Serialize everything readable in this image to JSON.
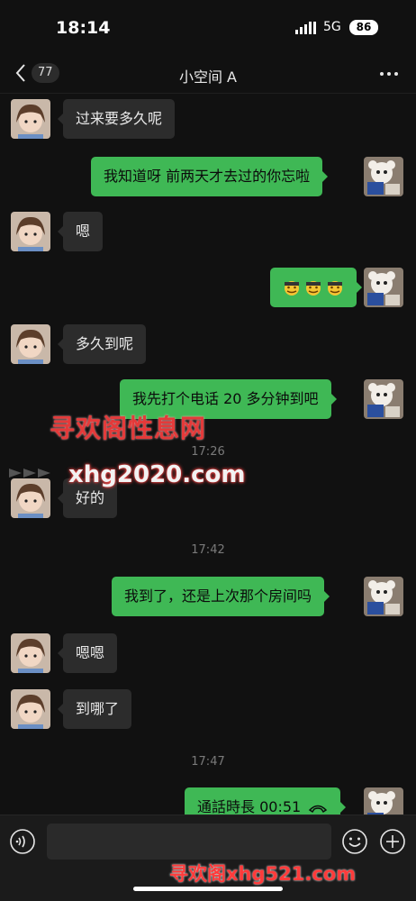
{
  "status_bar": {
    "time": "18:14",
    "network": "5G",
    "battery": "86"
  },
  "nav": {
    "back_count": "77",
    "title": "小空间 A"
  },
  "messages": [
    {
      "side": "in",
      "text": "过来要多久呢"
    },
    {
      "side": "out",
      "text": "我知道呀 前两天才去过的你忘啦"
    },
    {
      "side": "in",
      "text": "嗯"
    },
    {
      "side": "out",
      "emoji": [
        "sweat-smile-icon",
        "sweat-smile-icon",
        "sweat-smile-icon"
      ]
    },
    {
      "side": "in",
      "text": "多久到呢"
    },
    {
      "side": "out",
      "text": "我先打个电话 20 多分钟到吧"
    },
    {
      "side": "in",
      "text": "好的"
    },
    {
      "side": "out",
      "text": "我到了，还是上次那个房间吗"
    },
    {
      "side": "in",
      "text": "嗯嗯"
    },
    {
      "side": "in",
      "text": "到哪了"
    },
    {
      "side": "out",
      "text": "通話時長 00:51"
    }
  ],
  "timestamps": [
    "17:26",
    "17:42",
    "17:47"
  ],
  "watermarks": {
    "line1": "寻欢阁性息网",
    "line2": "xhg2020.com",
    "bottom": "寻欢阁xhg521.com"
  },
  "colors": {
    "outgoing_bubble": "#3fb855",
    "incoming_bubble": "#2c2c2c",
    "background": "#111111",
    "watermark": "#e43a3a"
  }
}
